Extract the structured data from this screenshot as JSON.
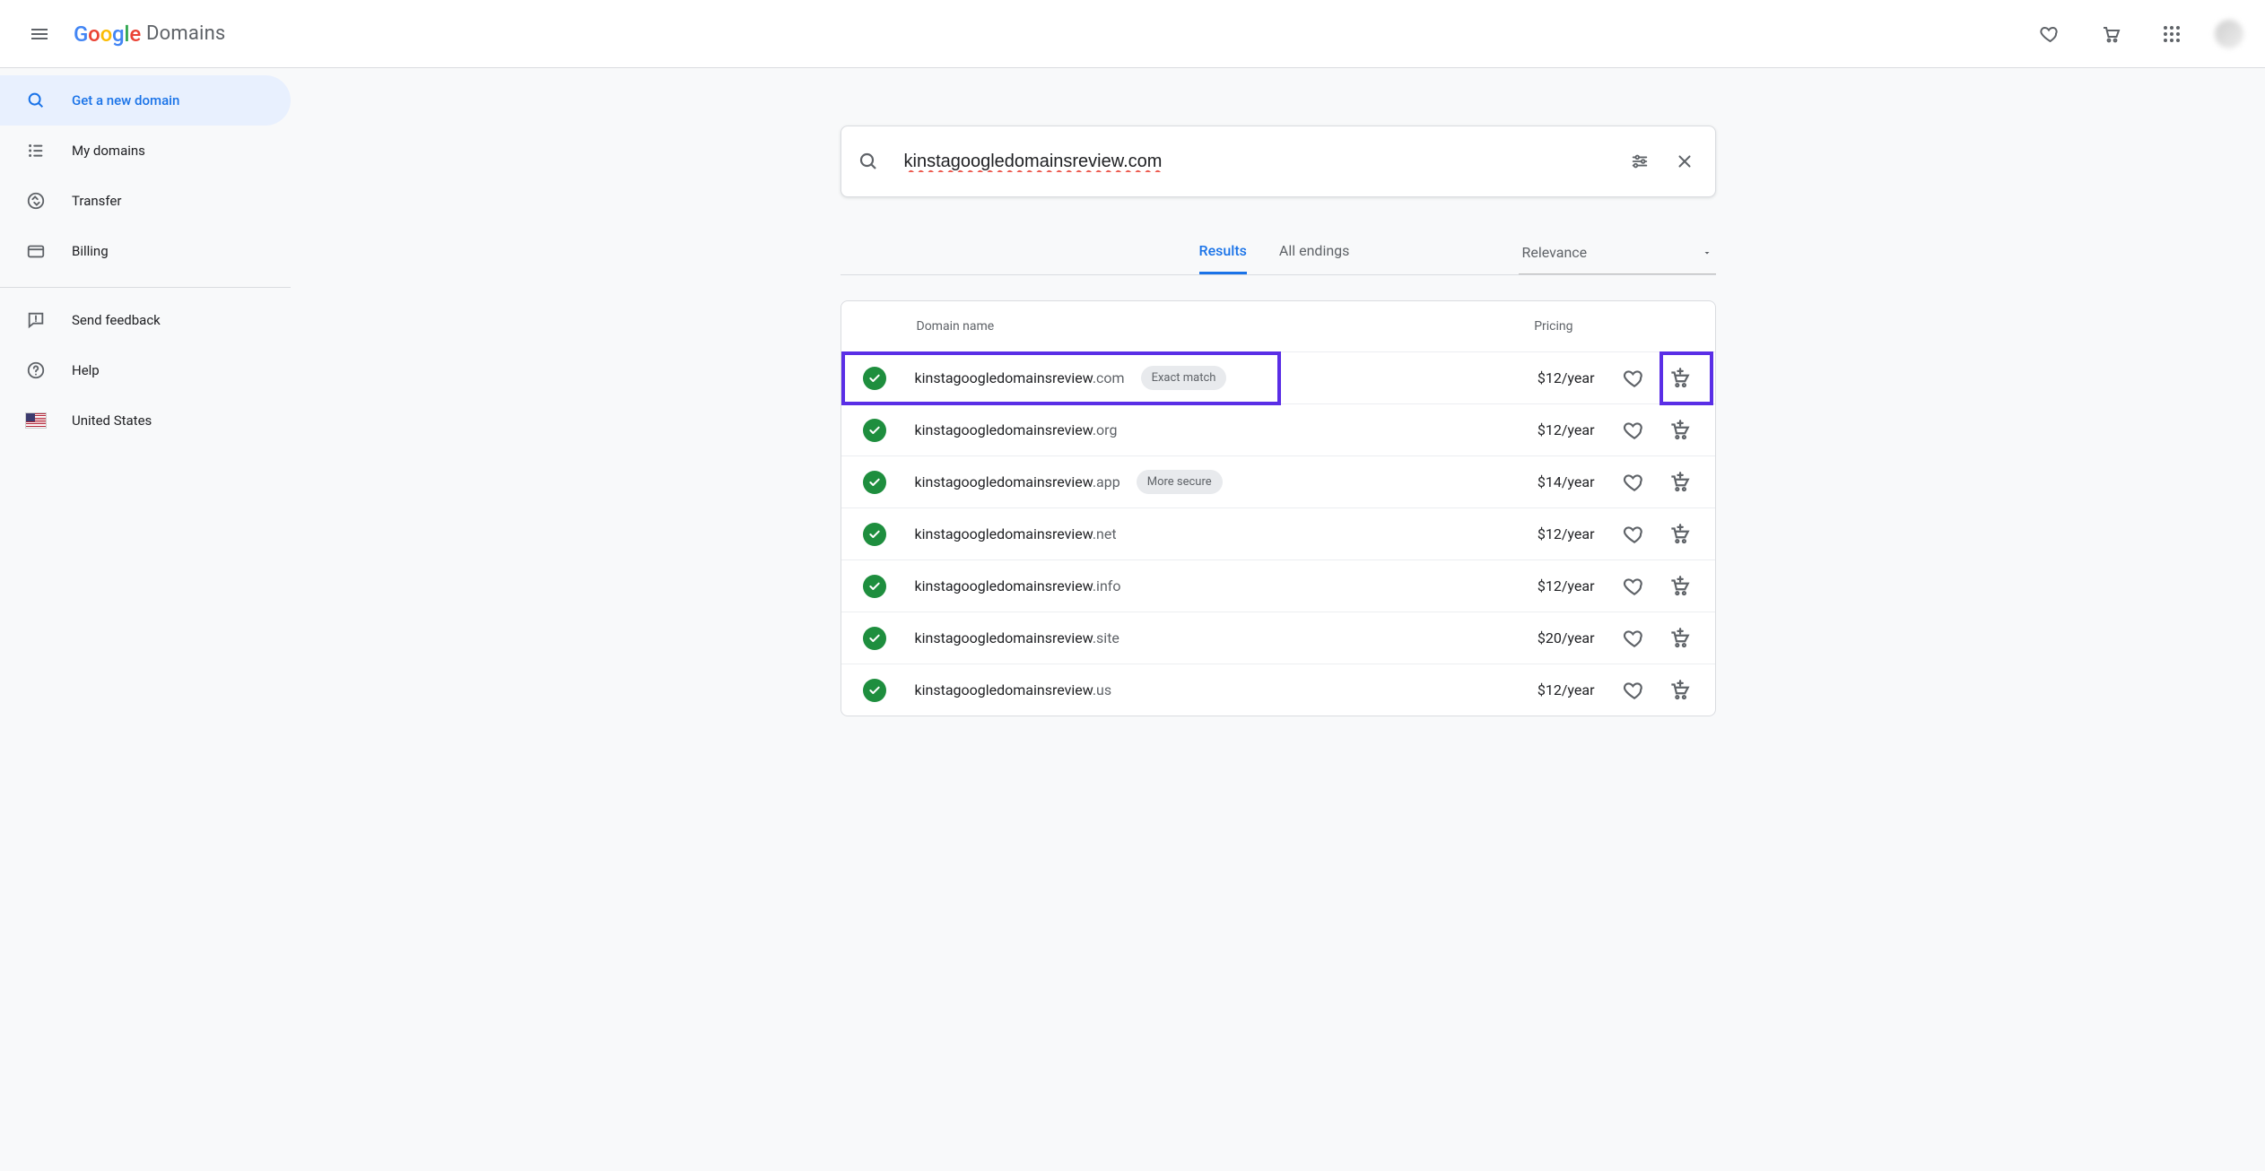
{
  "header": {
    "logo_product": "Domains"
  },
  "sidebar": {
    "items": [
      {
        "label": "Get a new domain"
      },
      {
        "label": "My domains"
      },
      {
        "label": "Transfer"
      },
      {
        "label": "Billing"
      },
      {
        "label": "Send feedback"
      },
      {
        "label": "Help"
      },
      {
        "label": "United States"
      }
    ]
  },
  "search": {
    "value": "kinstagoogledomainsreview.com"
  },
  "tabs": {
    "results": "Results",
    "all_endings": "All endings"
  },
  "sort": {
    "selected": "Relevance"
  },
  "table": {
    "col_name": "Domain name",
    "col_price": "Pricing"
  },
  "results": [
    {
      "name": "kinstagoogledomainsreview",
      "tld": ".com",
      "badge": "Exact match",
      "price": "$12/year"
    },
    {
      "name": "kinstagoogledomainsreview",
      "tld": ".org",
      "badge": "",
      "price": "$12/year"
    },
    {
      "name": "kinstagoogledomainsreview",
      "tld": ".app",
      "badge": "More secure",
      "price": "$14/year"
    },
    {
      "name": "kinstagoogledomainsreview",
      "tld": ".net",
      "badge": "",
      "price": "$12/year"
    },
    {
      "name": "kinstagoogledomainsreview",
      "tld": ".info",
      "badge": "",
      "price": "$12/year"
    },
    {
      "name": "kinstagoogledomainsreview",
      "tld": ".site",
      "badge": "",
      "price": "$20/year"
    },
    {
      "name": "kinstagoogledomainsreview",
      "tld": ".us",
      "badge": "",
      "price": "$12/year"
    }
  ]
}
